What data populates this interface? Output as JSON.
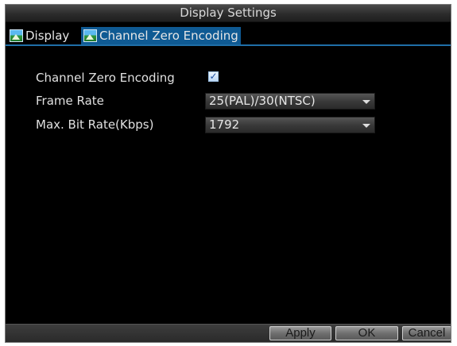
{
  "window": {
    "title": "Display Settings"
  },
  "tabs": [
    {
      "label": "Display",
      "icon": "picture-icon",
      "active": false
    },
    {
      "label": "Channel Zero Encoding",
      "icon": "picture-icon",
      "active": true
    }
  ],
  "form": {
    "channel_zero_encoding": {
      "label": "Channel Zero Encoding",
      "checked": true
    },
    "frame_rate": {
      "label": "Frame Rate",
      "value": "25(PAL)/30(NTSC)"
    },
    "max_bit_rate": {
      "label": "Max. Bit Rate(Kbps)",
      "value": "1792"
    }
  },
  "buttons": {
    "apply": "Apply",
    "ok": "OK",
    "cancel": "Cancel"
  },
  "colors": {
    "accent": "#0f5a93",
    "background": "#000000",
    "text": "#e0e0e0"
  }
}
